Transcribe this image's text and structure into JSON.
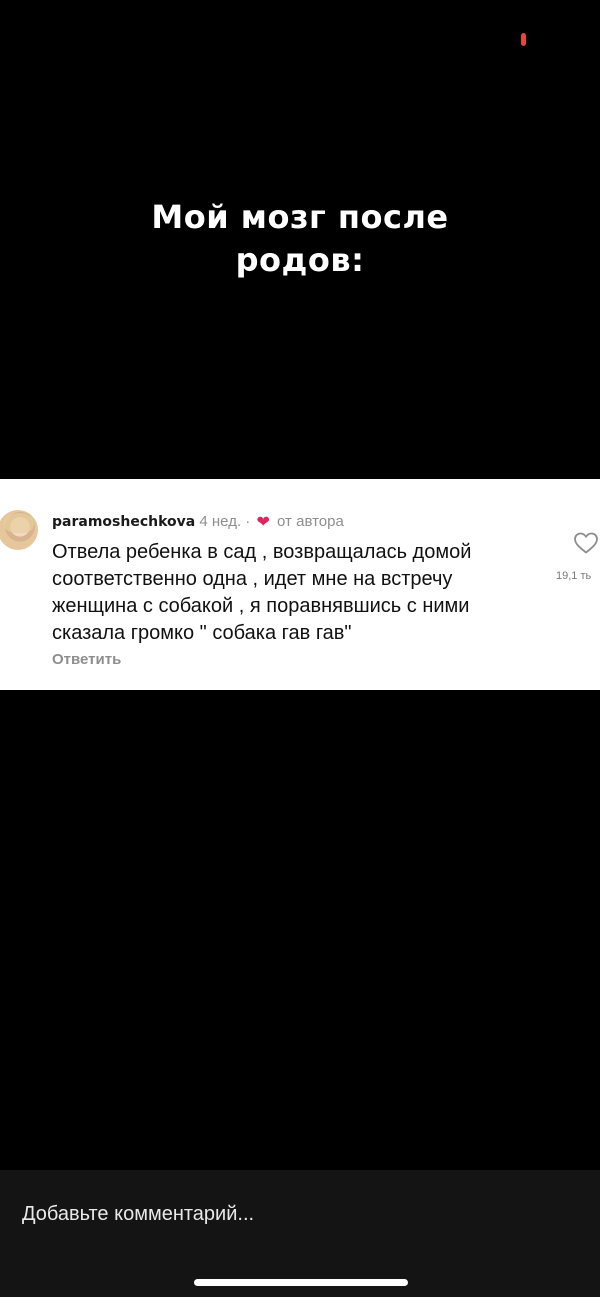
{
  "story": {
    "overlay_lines": [
      "Мой мозг после",
      "родов:"
    ],
    "progress_color": "#e8453c"
  },
  "comment": {
    "username": "paramoshechkova",
    "time": "4 нед.",
    "separator": "·",
    "liked_by_author_label": "от автора",
    "text_lines": [
      "Отвела ребенка в сад , возвращалась домой",
      "соответственно одна ,  идет мне на  встречу",
      "женщина с собакой , я поравнявшись  с ними",
      "сказала громко \" собака гав гав\""
    ],
    "reply_label": "Ответить",
    "likes_count": "19,1 ть",
    "icons": {
      "avatar": "user-avatar",
      "author_heart": "heart-filled-icon",
      "like": "heart-outline-icon"
    },
    "heart_color": "#e0245e"
  },
  "composer": {
    "placeholder": "Добавьте комментарий..."
  }
}
